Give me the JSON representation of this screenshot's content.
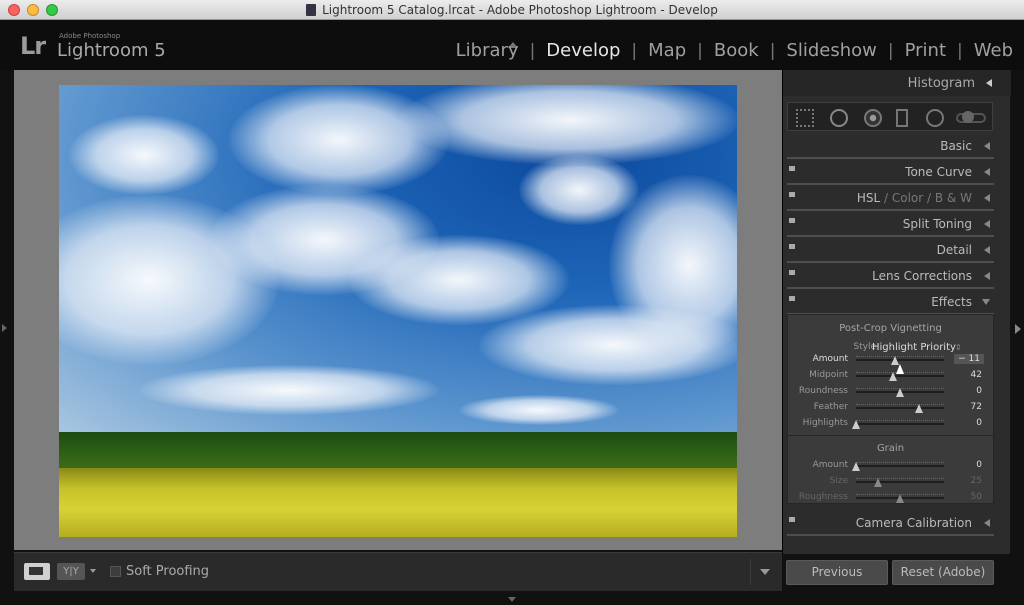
{
  "window": {
    "title": "Lightroom 5 Catalog.lrcat - Adobe Photoshop Lightroom - Develop"
  },
  "identity": {
    "logo": "Lr",
    "brand_small": "Adobe Photoshop",
    "brand_name": "Lightroom 5"
  },
  "modules": {
    "items": [
      "Library",
      "Develop",
      "Map",
      "Book",
      "Slideshow",
      "Print",
      "Web"
    ],
    "active": "Develop",
    "separator": "|"
  },
  "toolbar": {
    "view_mode": "loupe",
    "compare_label": "Y|Y",
    "soft_proofing_label": "Soft Proofing",
    "soft_proofing_checked": false
  },
  "right_panel": {
    "histogram_label": "Histogram",
    "tools": [
      "crop-overlay",
      "spot-removal",
      "red-eye-correction",
      "graduated-filter",
      "radial-filter",
      "adjustment-brush"
    ],
    "sections": {
      "basic": "Basic",
      "tone_curve": "Tone Curve",
      "hsl": {
        "hsl": "HSL",
        "sep1": "/",
        "color": "Color",
        "sep2": "/",
        "bw": "B & W"
      },
      "split_toning": "Split Toning",
      "detail": "Detail",
      "lens_corrections": "Lens Corrections",
      "effects": "Effects",
      "camera_calibration": "Camera Calibration"
    },
    "effects": {
      "vignette_title": "Post-Crop Vignetting",
      "style_label": "Style",
      "style_value": "Highlight Priority",
      "sliders": [
        {
          "label": "Amount",
          "value": "− 11",
          "position": 0.44
        },
        {
          "label": "Midpoint",
          "value": "42",
          "position": 0.42
        },
        {
          "label": "Roundness",
          "value": "0",
          "position": 0.5
        },
        {
          "label": "Feather",
          "value": "72",
          "position": 0.72
        },
        {
          "label": "Highlights",
          "value": "0",
          "position": 0.0
        }
      ],
      "grain_title": "Grain",
      "grain_sliders": [
        {
          "label": "Amount",
          "value": "0",
          "position": 0.0
        },
        {
          "label": "Size",
          "value": "25",
          "position": 0.25
        },
        {
          "label": "Roughness",
          "value": "50",
          "position": 0.5
        }
      ]
    },
    "previous_label": "Previous",
    "reset_label": "Reset (Adobe)"
  },
  "colors": {
    "accent_active": "#e6e6e6",
    "panel_bg": "#2c2c2c",
    "sky": "#1f66b8",
    "field_yellow": "#d8d237"
  }
}
